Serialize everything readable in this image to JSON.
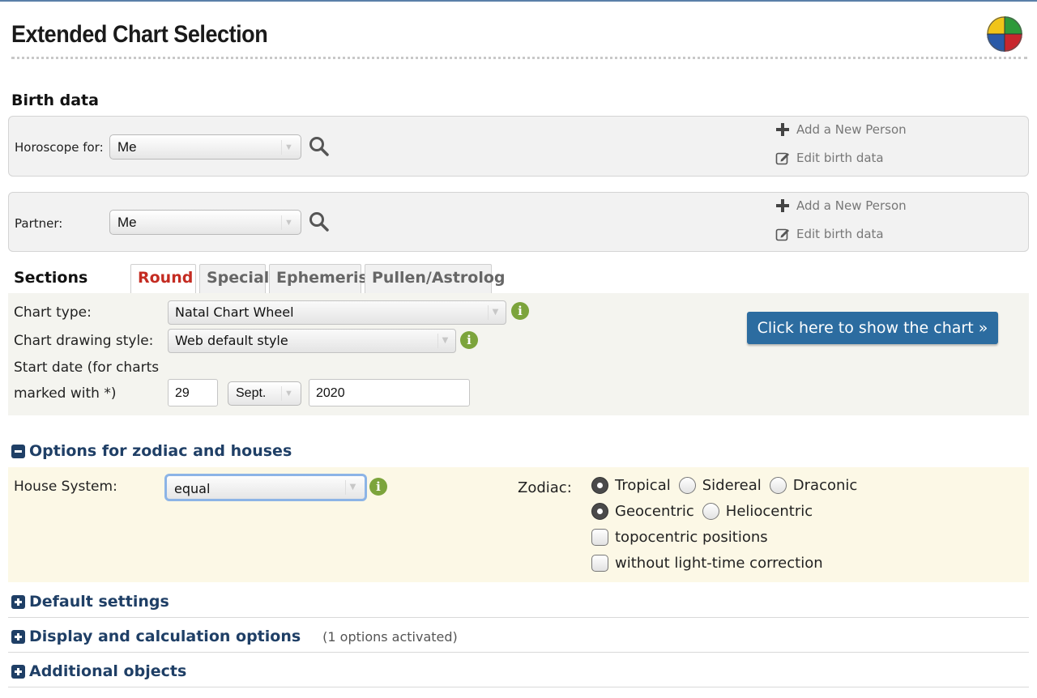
{
  "page": {
    "title": "Extended Chart Selection"
  },
  "birth_data": {
    "heading": "Birth data",
    "horoscope": {
      "label": "Horoscope for:",
      "selected": "Me",
      "add_person": "Add a New Person",
      "edit": "Edit birth data"
    },
    "partner": {
      "label": "Partner:",
      "selected": "Me",
      "add_person": "Add a New Person",
      "edit": "Edit birth data"
    }
  },
  "sections": {
    "heading": "Sections",
    "tabs": [
      {
        "label": "Round",
        "active": true
      },
      {
        "label": "Special",
        "active": false
      },
      {
        "label": "Ephemeris",
        "active": false
      },
      {
        "label": "Pullen/Astrolog",
        "active": false
      }
    ],
    "chart_type_label": "Chart type:",
    "chart_type_value": "Natal Chart Wheel",
    "drawing_style_label": "Chart drawing style:",
    "drawing_style_value": "Web default style",
    "start_date_label_1": "Start date (for charts",
    "start_date_label_2": "marked with *)",
    "day": "29",
    "month": "Sept.",
    "year": "2020",
    "show_button": "Click here to show the chart »"
  },
  "zodiac_houses": {
    "heading": "Options for zodiac and houses",
    "house_system_label": "House System:",
    "house_system_value": "equal",
    "zodiac_label": "Zodiac:",
    "zodiac_options": [
      "Tropical",
      "Sidereal",
      "Draconic"
    ],
    "zodiac_selected": "Tropical",
    "center_options": [
      "Geocentric",
      "Heliocentric"
    ],
    "center_selected": "Geocentric",
    "topocentric": "topocentric positions",
    "light_time": "without light-time correction"
  },
  "collapsed": {
    "default_settings": "Default settings",
    "display_calc": "Display and calculation options",
    "display_calc_note": "(1 options activated)",
    "additional_objects": "Additional objects"
  },
  "colors": {
    "accent_blue": "#2c6ca0",
    "heading_navy": "#1f3f66",
    "active_tab_red": "#c42c22",
    "info_green": "#7ca43c"
  },
  "icons": {
    "search": "search-icon",
    "add": "plus-icon",
    "edit": "edit-icon",
    "info": "info-icon",
    "logo": "astro-logo-icon"
  }
}
